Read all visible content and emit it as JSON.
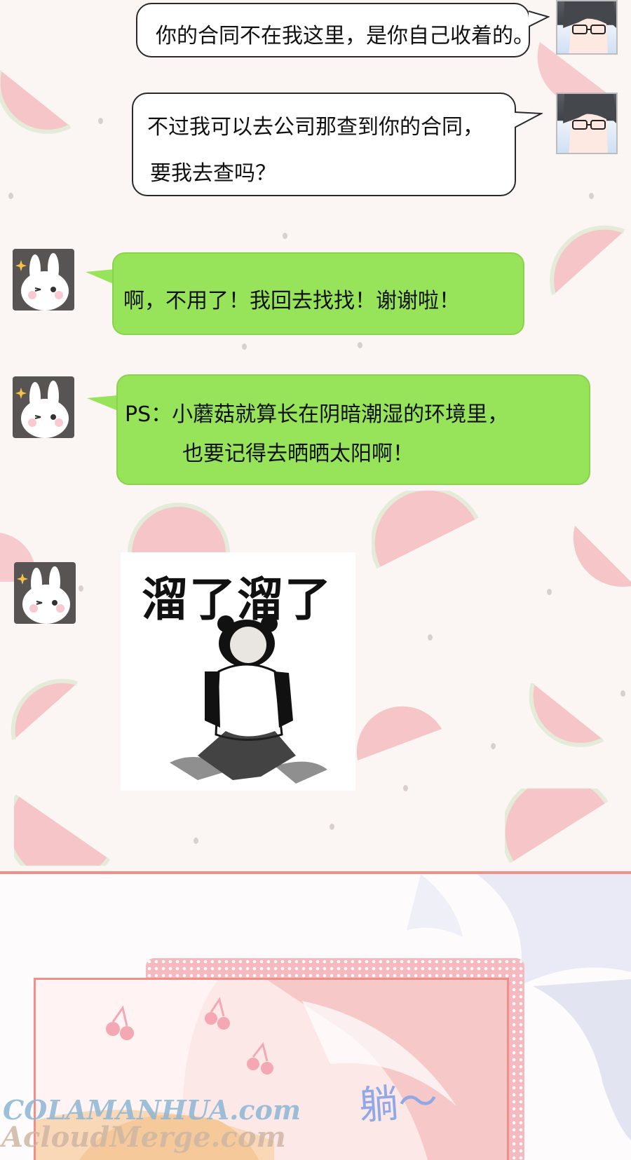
{
  "messages": [
    {
      "side": "right",
      "style": "white",
      "lines": [
        "你的合同不在我这里，是你自己收着的。"
      ]
    },
    {
      "side": "right",
      "style": "white",
      "lines": [
        "不过我可以去公司那查到你的合同，",
        "要我去查吗？"
      ]
    },
    {
      "side": "left",
      "style": "green",
      "lines": [
        "啊，不用了！我回去找找！谢谢啦！"
      ]
    },
    {
      "side": "left",
      "style": "green",
      "lines": [
        "PS：小蘑菇就算长在阴暗潮湿的环境里，",
        "也要记得去晒晒太阳啊！"
      ]
    }
  ],
  "sticker": {
    "caption": "溜了溜了"
  },
  "avatars": {
    "contact": "man-with-glasses-avatar",
    "self": "bunny-avatar"
  },
  "sound_effect": "躺～",
  "watermark": {
    "line1": "COLAMANHUA.com",
    "line2": "AcloudMerge.com"
  },
  "colors": {
    "green_bubble": "#97e35a",
    "divider": "#ef8f88",
    "watermelon": "#f6c5c8"
  }
}
